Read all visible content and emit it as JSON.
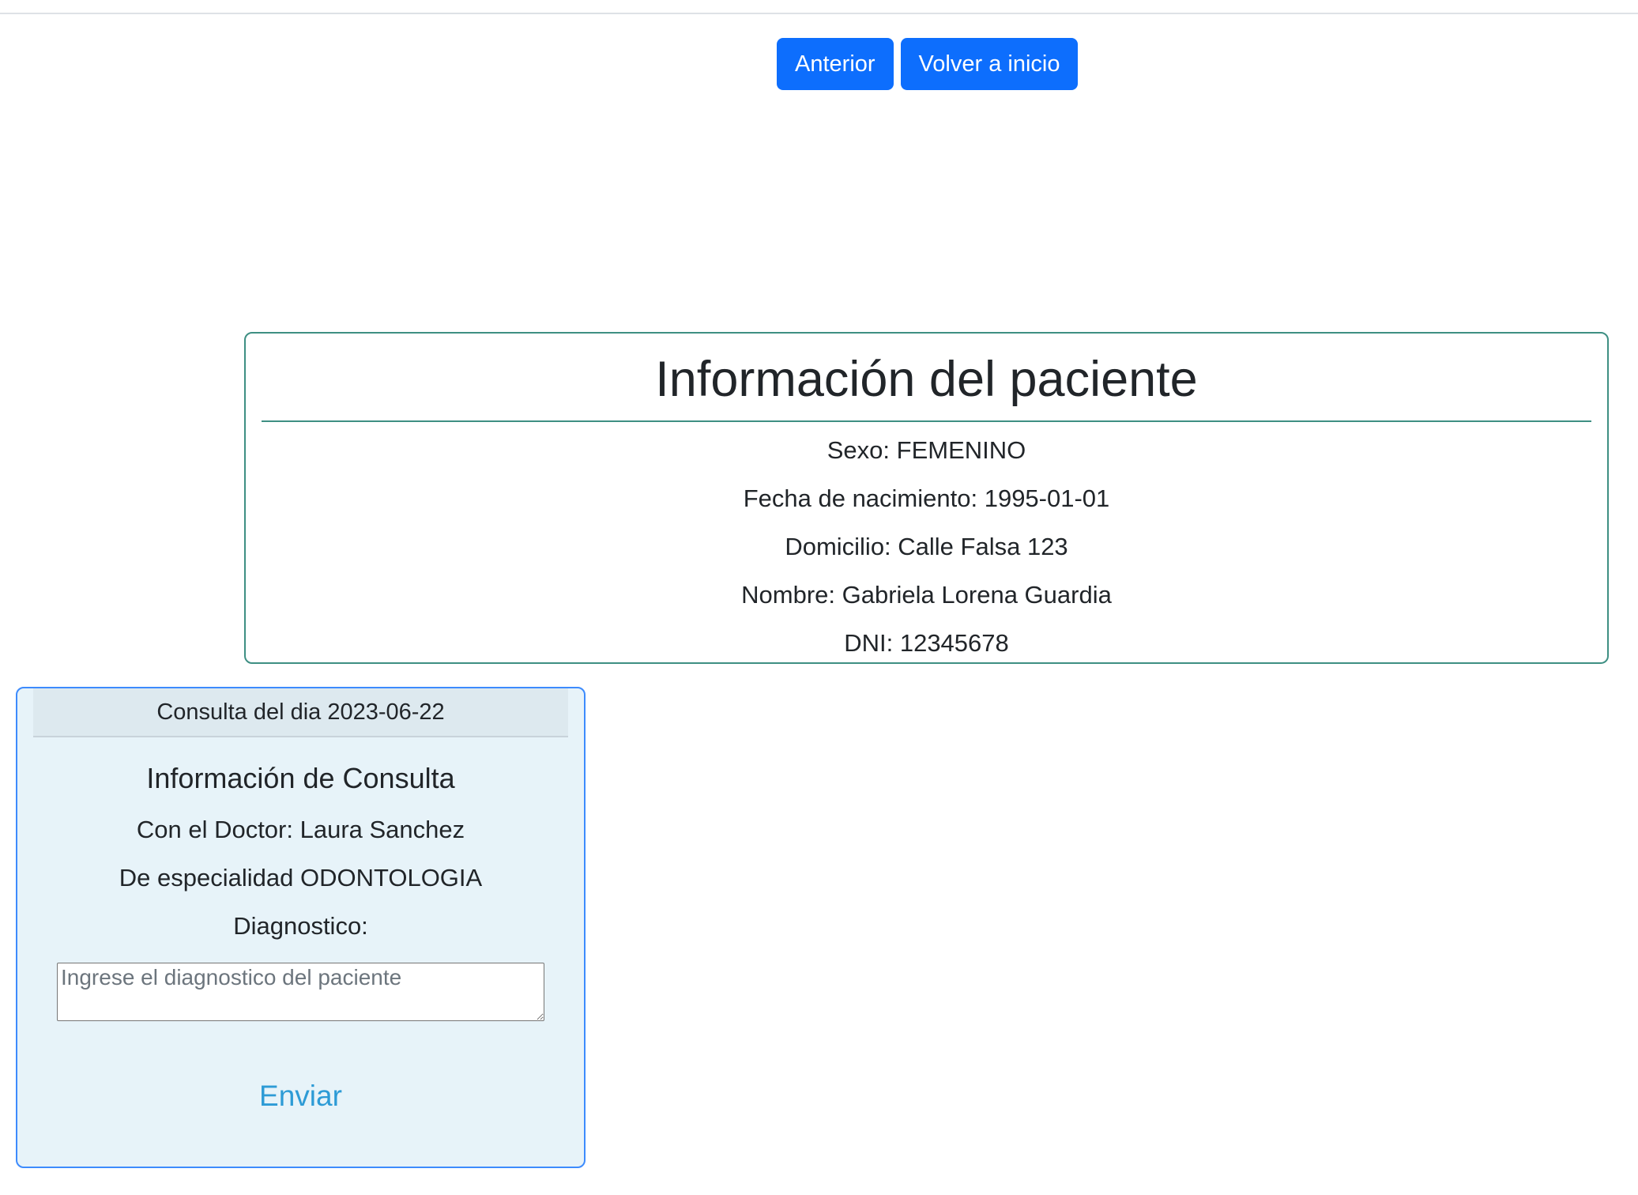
{
  "nav": {
    "prev_label": "Anterior",
    "home_label": "Volver a inicio"
  },
  "patient": {
    "title": "Información del paciente",
    "sexo": "Sexo: FEMENINO",
    "fecha_nacimiento": "Fecha de nacimiento: 1995-01-01",
    "domicilio": "Domicilio: Calle Falsa 123",
    "nombre": "Nombre: Gabriela Lorena Guardia",
    "dni": "DNI: 12345678"
  },
  "consulta": {
    "header": "Consulta del dia 2023-06-22",
    "title": "Información de Consulta",
    "doctor": "Con el Doctor: Laura Sanchez",
    "especialidad": "De especialidad ODONTOLOGIA",
    "diagnostico_label": "Diagnostico:",
    "diagnostico_placeholder": "Ingrese el diagnostico del paciente",
    "diagnostico_value": "",
    "send_label": "Enviar"
  },
  "colors": {
    "primary_button": "#0d6efd",
    "patient_border": "#3e8f83",
    "consult_border": "#3d8bfd",
    "consult_background": "#e7f3f9",
    "send_link": "#2d9bd6"
  }
}
